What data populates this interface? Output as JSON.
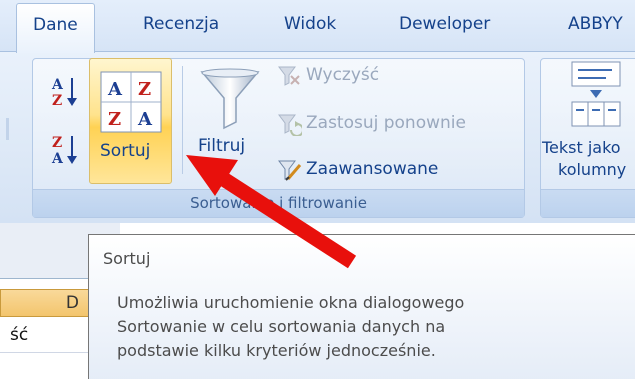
{
  "tabs": [
    {
      "label": "Dane",
      "active": true
    },
    {
      "label": "Recenzja",
      "active": false
    },
    {
      "label": "Widok",
      "active": false
    },
    {
      "label": "Deweloper",
      "active": false
    },
    {
      "label": "ABBYY",
      "active": false
    }
  ],
  "ribbon": {
    "group_caption": "Sortowanie i filtrowanie",
    "sort_button_label": "Sortuj",
    "filter_button_label": "Filtruj",
    "commands": {
      "clear": "Wyczyść",
      "reapply": "Zastosuj ponownie",
      "advanced": "Zaawansowane"
    },
    "text_to_columns": {
      "line1": "Tekst jako",
      "line2": "kolumny"
    }
  },
  "sheet": {
    "column_header": "D",
    "cell_text": "ść"
  },
  "tooltip": {
    "title": "Sortuj",
    "body_lines": [
      "Umożliwia uruchomienie okna dialogowego",
      "Sortowanie w celu sortowania danych na",
      "podstawie kilku kryteriów jednocześnie."
    ]
  },
  "colors": {
    "ribbon_text": "#15428b",
    "hover_button": "#ffd254",
    "annotation_arrow": "#e8100c"
  }
}
